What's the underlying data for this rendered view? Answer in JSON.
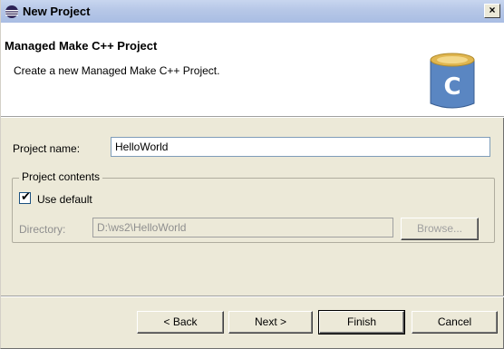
{
  "window": {
    "title": "New Project",
    "close_glyph": "×"
  },
  "header": {
    "title": "Managed Make C++ Project",
    "description": "Create a new Managed Make C++ Project.",
    "icon_letter": "C"
  },
  "form": {
    "project_name_label": "Project name:",
    "project_name_value": "HelloWorld",
    "group_label": "Project contents",
    "use_default_label": "Use default",
    "use_default_checked": true,
    "directory_label": "Directory:",
    "directory_value": "D:\\ws2\\HelloWorld",
    "browse_label": "Browse..."
  },
  "buttons": {
    "back": "< Back",
    "next": "Next >",
    "finish": "Finish",
    "cancel": "Cancel"
  },
  "colors": {
    "accent": "#0a246a",
    "icon_blue": "#5a86c2",
    "icon_gold": "#e0b650"
  }
}
